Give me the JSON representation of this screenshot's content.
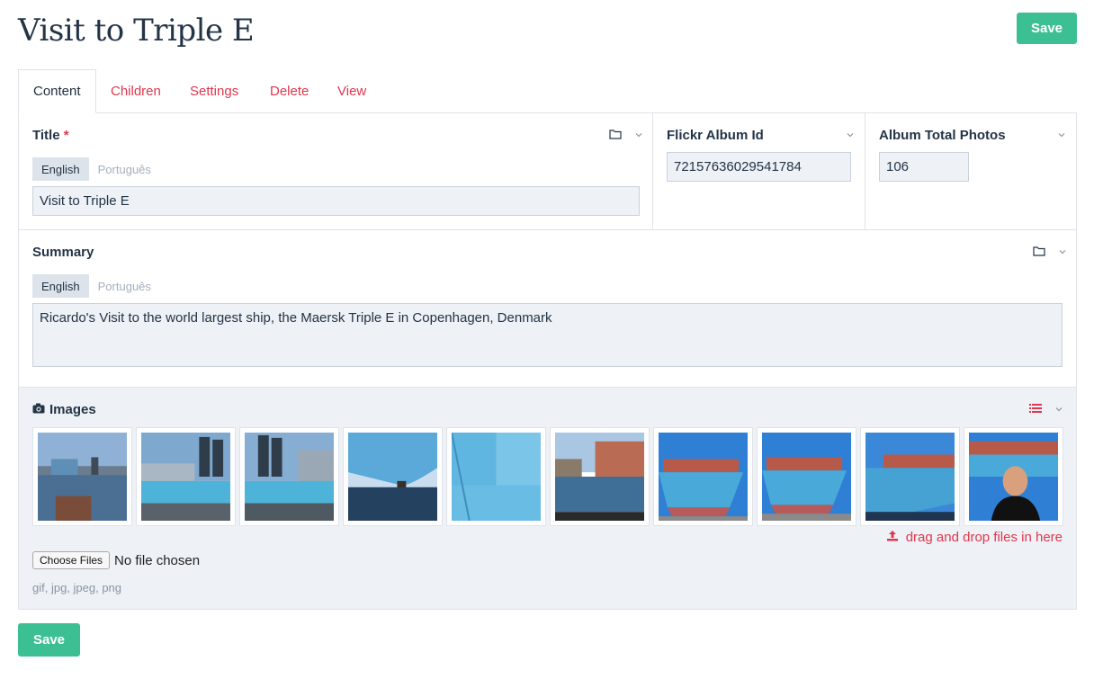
{
  "page": {
    "title": "Visit to Triple E"
  },
  "actions": {
    "save_label": "Save"
  },
  "tabs": [
    {
      "label": "Content",
      "active": true
    },
    {
      "label": "Children"
    },
    {
      "label": "Settings"
    },
    {
      "label": "Delete"
    },
    {
      "label": "View"
    }
  ],
  "fields": {
    "title": {
      "label": "Title",
      "required_mark": "*",
      "languages": [
        "English",
        "Português"
      ],
      "value": "Visit to Triple E"
    },
    "flickr": {
      "label": "Flickr Album Id",
      "value": "72157636029541784"
    },
    "total": {
      "label": "Album Total Photos",
      "value": "106"
    },
    "summary": {
      "label": "Summary",
      "languages": [
        "English",
        "Português"
      ],
      "value": "Ricardo's Visit to the world largest ship, the Maersk Triple E in Copenhagen, Denmark"
    }
  },
  "images": {
    "label": "Images",
    "thumbnails": [
      "harbor-photo",
      "ship-dock-photo",
      "ship-dock-photo",
      "ship-hull-photo",
      "ship-deck-photo",
      "canal-photo",
      "ship-bow-photo",
      "ship-bow-photo",
      "ship-bow-photo",
      "person-ship-photo"
    ],
    "dnd_label": "drag and drop files in here",
    "choose_label": "Choose Files",
    "no_file_label": "No file chosen",
    "extensions": "gif, jpg, jpeg, png"
  },
  "colors": {
    "accent": "#e0374e",
    "save": "#3dbf94",
    "background": "#eef1f5"
  }
}
